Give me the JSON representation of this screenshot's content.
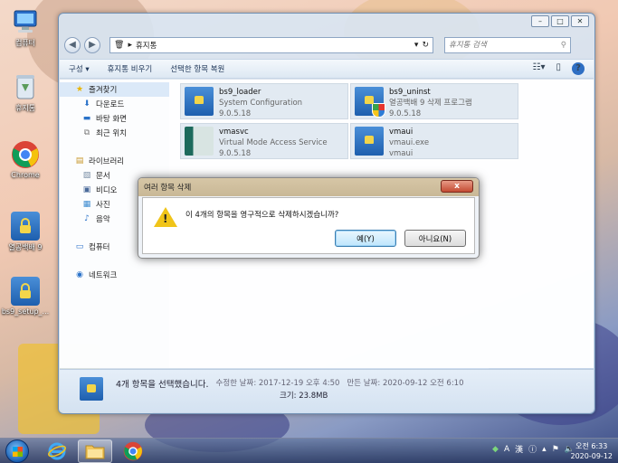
{
  "desktop": {
    "icons": [
      {
        "label": "컴퓨터"
      },
      {
        "label": "휴지통"
      },
      {
        "label": "Chrome"
      },
      {
        "label": "열공백배 9"
      },
      {
        "label": "bs9_setup_..."
      }
    ]
  },
  "explorer": {
    "address_path": "휴지통",
    "search_placeholder": "휴지통 검색",
    "commands": {
      "organize": "구성 ▾",
      "empty": "휴지통 비우기",
      "restore": "선택한 항목 복원"
    },
    "sidebar": {
      "favorites": "즐겨찾기",
      "downloads": "다운로드",
      "desktop": "바탕 화면",
      "recent": "최근 위치",
      "libraries": "라이브러리",
      "documents": "문서",
      "videos": "비디오",
      "pictures": "사진",
      "music": "음악",
      "computer": "컴퓨터",
      "network": "네트워크"
    },
    "items": [
      {
        "name": "bs9_loader",
        "desc": "System Configuration",
        "version": "9.0.5.18"
      },
      {
        "name": "bs9_uninst",
        "desc": "열공백배 9 삭제 프로그램",
        "version": "9.0.5.18"
      },
      {
        "name": "vmasvc",
        "desc": "Virtual Mode Access Service",
        "version": "9.0.5.18"
      },
      {
        "name": "vmaui",
        "desc": "vmaui.exe",
        "version": "vmaui"
      }
    ],
    "status": {
      "selected": "4개 항목을 선택했습니다.",
      "modified": "수정한 날짜: 2017-12-19 오후 4:50",
      "created": "만든 날짜: 2020-09-12 오전 6:10",
      "size": "크기: 23.8MB"
    }
  },
  "dialog": {
    "title": "여러 항목 삭제",
    "close": "x",
    "message": "이 4개의 항목을 영구적으로 삭제하시겠습니까?",
    "yes": "예(Y)",
    "no": "아니요(N)"
  },
  "taskbar": {
    "clock_time": "오전 6:33",
    "clock_date": "2020-09-12",
    "ime": "A",
    "ime2": "漢"
  },
  "colors": {
    "accent": "#1e5fae",
    "dialog_title": "#c9b896",
    "close_button": "#c44b32"
  }
}
